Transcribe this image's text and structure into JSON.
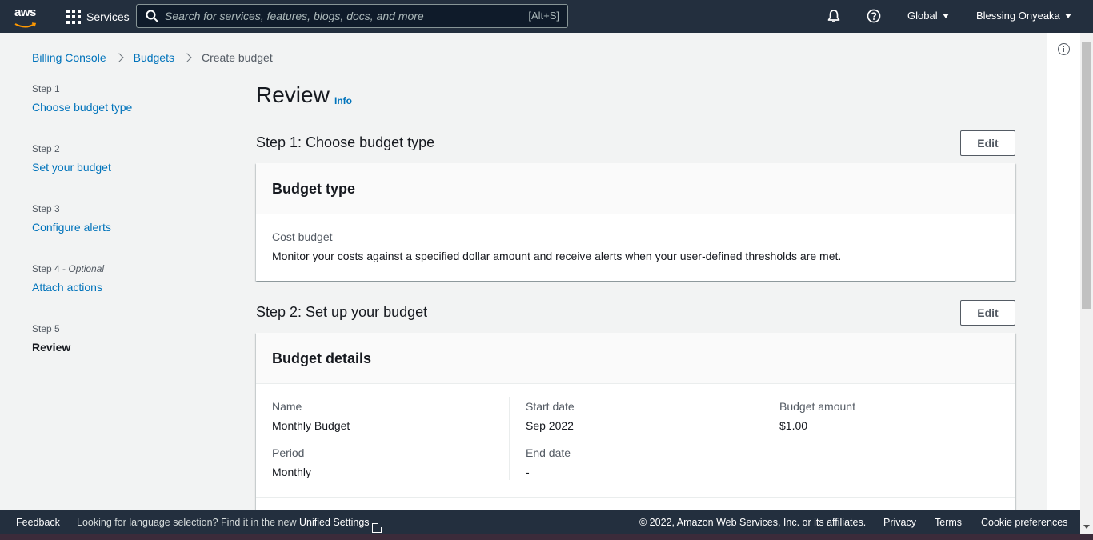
{
  "topnav": {
    "logo_text": "aws",
    "services_label": "Services",
    "search_placeholder": "Search for services, features, blogs, docs, and more",
    "search_shortcut": "[Alt+S]",
    "region_label": "Global",
    "user_label": "Blessing Onyeaka"
  },
  "breadcrumb": {
    "items": [
      "Billing Console",
      "Budgets",
      "Create budget"
    ]
  },
  "steps": [
    {
      "num": "Step 1",
      "label": "Choose budget type"
    },
    {
      "num": "Step 2",
      "label": "Set your budget"
    },
    {
      "num": "Step 3",
      "label": "Configure alerts"
    },
    {
      "num": "Step 4",
      "optional": "Optional",
      "label": "Attach actions"
    },
    {
      "num": "Step 5",
      "label": "Review"
    }
  ],
  "main": {
    "title": "Review",
    "info_link": "Info",
    "section1": {
      "title": "Step 1: Choose budget type",
      "edit_label": "Edit",
      "card_title": "Budget type",
      "type_name": "Cost budget",
      "type_desc": "Monitor your costs against a specified dollar amount and receive alerts when your user-defined thresholds are met."
    },
    "section2": {
      "title": "Step 2: Set up your budget",
      "edit_label": "Edit",
      "card_title": "Budget details",
      "name_label": "Name",
      "name_value": "Monthly Budget",
      "period_label": "Period",
      "period_value": "Monthly",
      "start_label": "Start date",
      "start_value": "Sep 2022",
      "end_label": "End date",
      "end_value": "-",
      "amount_label": "Budget amount",
      "amount_value": "$1.00"
    }
  },
  "footer": {
    "feedback": "Feedback",
    "language_text": "Looking for language selection? Find it in the new",
    "unified_settings": "Unified Settings",
    "copyright": "© 2022, Amazon Web Services, Inc. or its affiliates.",
    "privacy": "Privacy",
    "terms": "Terms",
    "cookies": "Cookie preferences"
  },
  "colors": {
    "nav_bg": "#232f3e",
    "link": "#0073bb",
    "page_bg": "#f2f3f3"
  }
}
